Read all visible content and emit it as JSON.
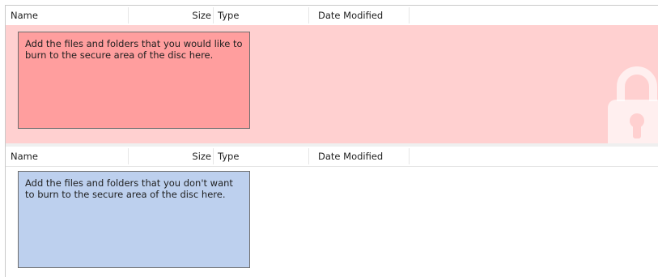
{
  "secure_section": {
    "columns": {
      "name": "Name",
      "size": "Size",
      "type": "Type",
      "date_modified": "Date Modified"
    },
    "hint_text": "Add the files and folders that you would like to burn to the secure area of the disc here.",
    "background_color": "#ffd0d0",
    "hint_box_color": "#ff9e9e",
    "watermark_icon": "lock-icon"
  },
  "normal_section": {
    "columns": {
      "name": "Name",
      "size": "Size",
      "type": "Type",
      "date_modified": "Date Modified"
    },
    "hint_text": "Add the files and folders that you don't want to burn to the secure area of the disc here.",
    "hint_box_color": "#bdd0ee"
  }
}
